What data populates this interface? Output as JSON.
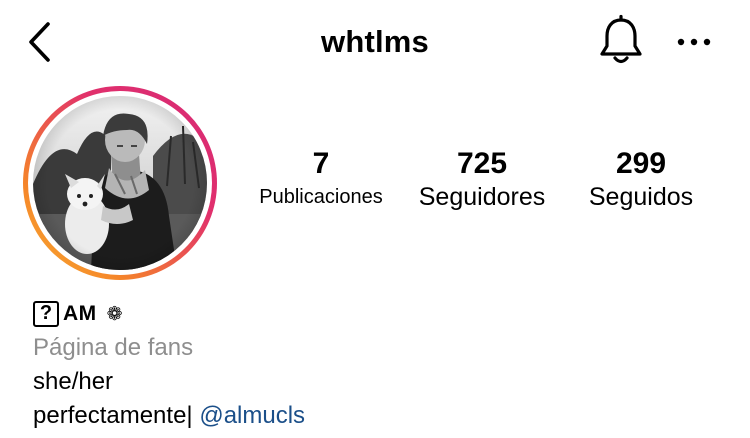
{
  "header": {
    "username": "whtlms",
    "back_icon": "chevron-left-icon",
    "notifications_icon": "bell-icon",
    "more_icon": "more-horizontal-icon"
  },
  "avatar": {
    "ring_colors": [
      "#f9b233",
      "#f58529",
      "#e1306c",
      "#d62976"
    ]
  },
  "stats": {
    "posts": {
      "value": "7",
      "label": "Publicaciones"
    },
    "followers": {
      "value": "725",
      "label": "Seguidores"
    },
    "following": {
      "value": "299",
      "label": "Seguidos"
    }
  },
  "bio": {
    "name_box": "?",
    "name_text": "AM",
    "name_emoji": "❁",
    "category": "Página de fans",
    "line1": "she/her",
    "line2_prefix": "perfectamente| ",
    "mention": "@almucls",
    "mention_color": "#1b4f89"
  }
}
